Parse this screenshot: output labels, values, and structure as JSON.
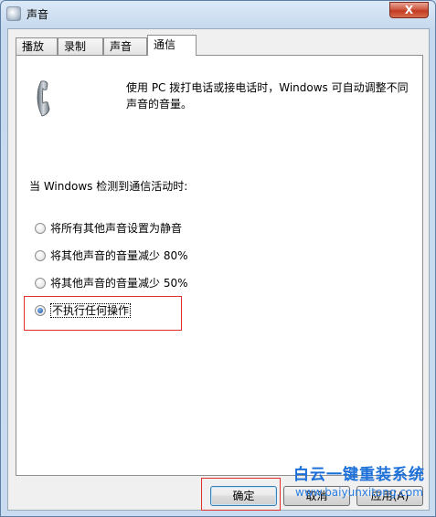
{
  "window": {
    "title": "声音",
    "close_label": "X"
  },
  "tabs": [
    {
      "label": "播放",
      "active": false
    },
    {
      "label": "录制",
      "active": false
    },
    {
      "label": "声音",
      "active": false
    },
    {
      "label": "通信",
      "active": true
    }
  ],
  "communications": {
    "description": "使用 PC 拨打电话或接电话时，Windows 可自动调整不同声音的音量。",
    "subheading": "当 Windows 检测到通信活动时:",
    "options": [
      {
        "label": "将所有其他声音设置为静音",
        "checked": false
      },
      {
        "label": "将其他声音的音量减少 80%",
        "checked": false
      },
      {
        "label": "将其他声音的音量减少 50%",
        "checked": false
      },
      {
        "label": "不执行任何操作",
        "checked": true
      }
    ]
  },
  "buttons": {
    "ok": "确定",
    "cancel": "取消",
    "apply": "应用(A)"
  },
  "watermark": {
    "title": "白云一键重装系统",
    "url": "www.baiyunxitong.com"
  },
  "colors": {
    "highlight_box": "#e0302c",
    "watermark": "#1b6fd8"
  }
}
